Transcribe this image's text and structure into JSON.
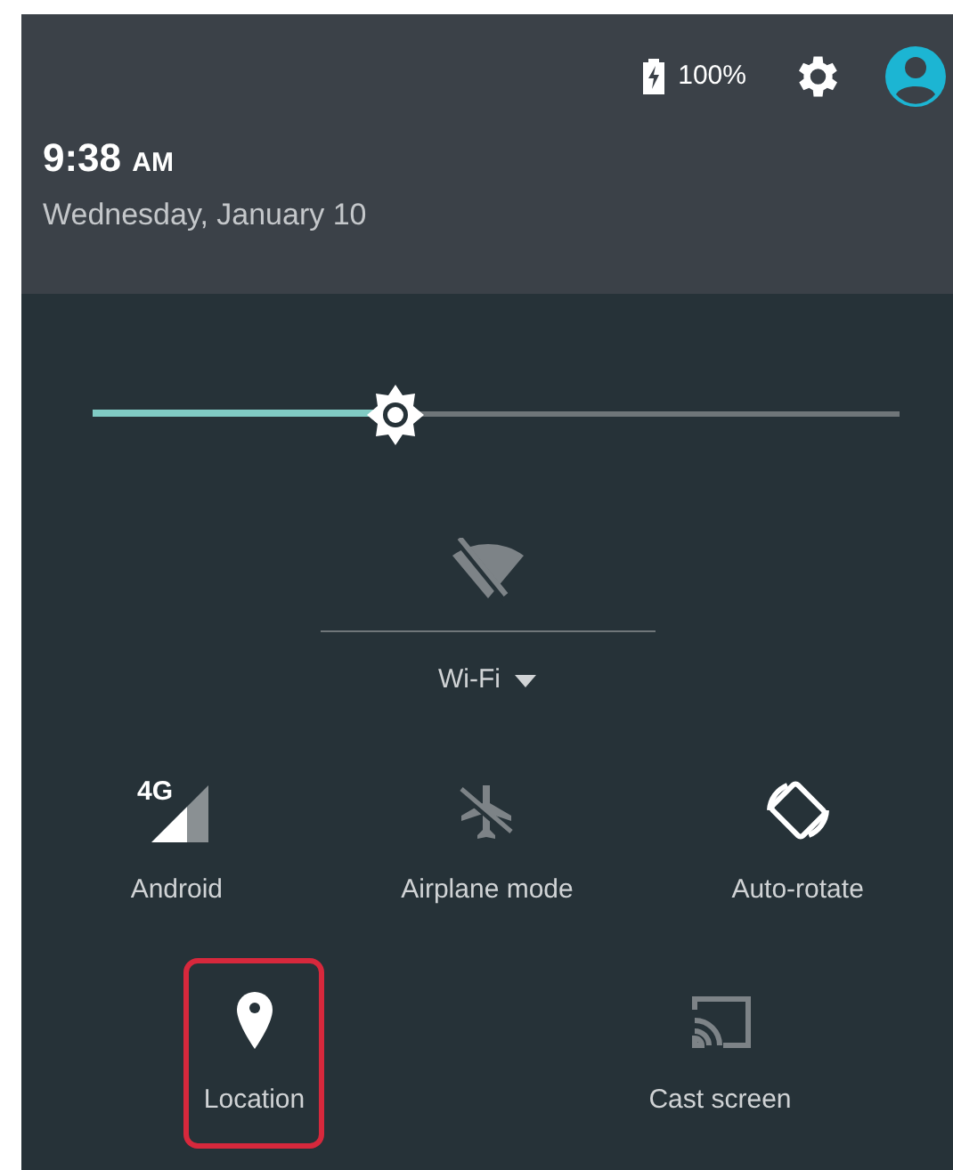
{
  "header": {
    "battery": "100%",
    "time": "9:38",
    "meridiem": "AM",
    "date": "Wednesday, January 10"
  },
  "brightness": {
    "level": 0.375
  },
  "wifi": {
    "label": "Wi-Fi",
    "on": false
  },
  "tiles": [
    {
      "kind": "cellular",
      "label": "Android",
      "badge": "4G",
      "on": true,
      "highlighted": false
    },
    {
      "kind": "airplane",
      "label": "Airplane mode",
      "on": false,
      "highlighted": false
    },
    {
      "kind": "rotate",
      "label": "Auto-rotate",
      "on": true,
      "highlighted": false
    },
    {
      "kind": "location",
      "label": "Location",
      "on": true,
      "highlighted": true
    },
    {
      "kind": "cast",
      "label": "Cast screen",
      "on": false,
      "highlighted": false
    }
  ]
}
